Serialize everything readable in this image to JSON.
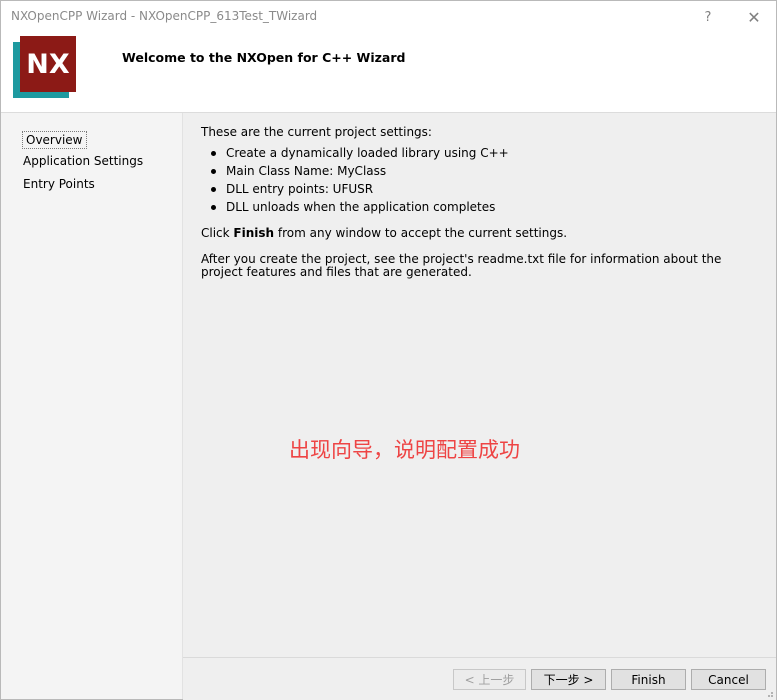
{
  "window": {
    "title": "NXOpenCPP Wizard - NXOpenCPP_613Test_TWizard",
    "help_label": "?",
    "close_label": "✕"
  },
  "header": {
    "logo_text": "NX",
    "title": "Welcome to the NXOpen for C++ Wizard",
    "colors": {
      "logo_red": "#8c1a16",
      "logo_teal": "#1e9aa0"
    }
  },
  "sidebar": {
    "items": [
      {
        "label": "Overview",
        "selected": true
      },
      {
        "label": "Application Settings",
        "selected": false
      },
      {
        "label": "Entry Points",
        "selected": false
      }
    ]
  },
  "content": {
    "intro": "These are the current project settings:",
    "bullets": [
      "Create a dynamically loaded library using C++",
      "Main Class Name: MyClass",
      "DLL entry points: UFUSR",
      "DLL unloads when the application completes"
    ],
    "finish_prefix": "Click ",
    "finish_bold": "Finish",
    "finish_suffix": " from any window to accept the current settings.",
    "after_create": "After you create the project, see the project's readme.txt file for information about the project features and files that are generated.",
    "annotation": "出现向导，说明配置成功",
    "annotation_color": "#ee4444"
  },
  "footer": {
    "back_label": "< 上一步",
    "next_label": "下一步 >",
    "finish_label": "Finish",
    "cancel_label": "Cancel"
  }
}
